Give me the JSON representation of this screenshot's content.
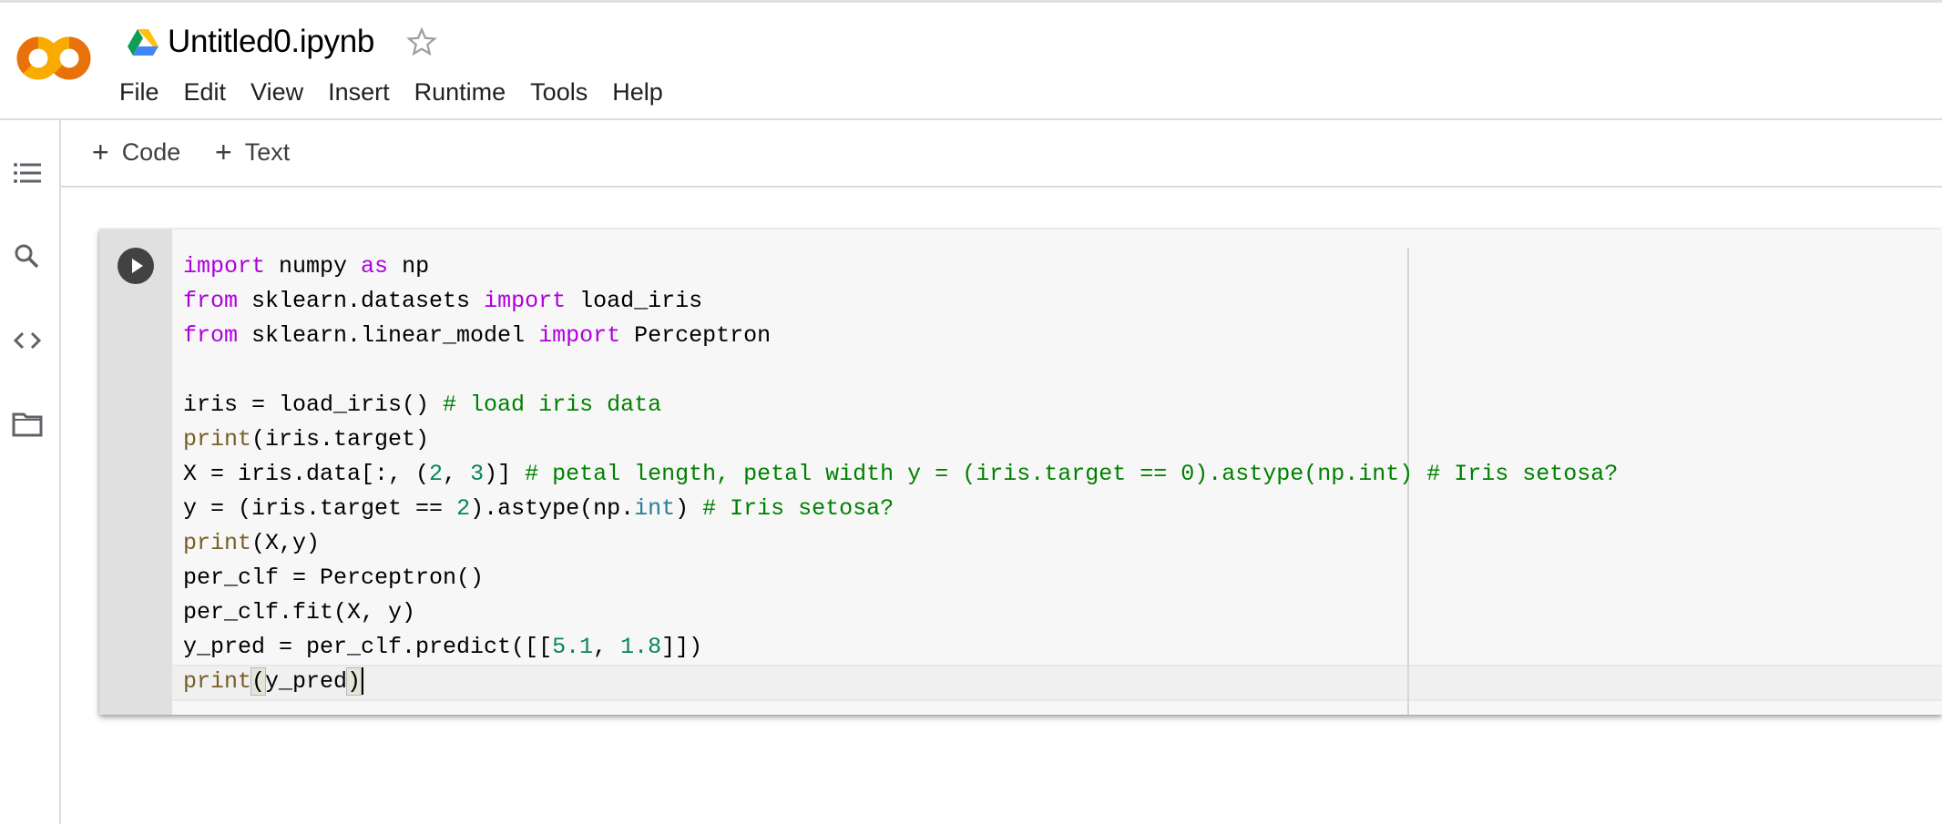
{
  "app": {
    "logo": "colab-logo",
    "title": "Untitled0.ipynb",
    "drive_icon": "google-drive-icon",
    "star_icon": "star-outline-icon"
  },
  "menu": [
    "File",
    "Edit",
    "View",
    "Insert",
    "Runtime",
    "Tools",
    "Help"
  ],
  "rail": [
    {
      "name": "table-of-contents-icon"
    },
    {
      "name": "search-icon"
    },
    {
      "name": "code-snippets-icon"
    },
    {
      "name": "files-icon"
    }
  ],
  "toolbar": {
    "add_code_label": "Code",
    "add_text_label": "Text"
  },
  "colors": {
    "keyword": "#af00db",
    "builtin": "#795e26",
    "comment": "#008000",
    "number": "#098658",
    "type": "#267f99"
  },
  "cell": {
    "run_button": "play-icon",
    "lines": [
      [
        {
          "t": "import",
          "c": "kw"
        },
        {
          "t": " numpy "
        },
        {
          "t": "as",
          "c": "kw"
        },
        {
          "t": " np"
        }
      ],
      [
        {
          "t": "from",
          "c": "kw"
        },
        {
          "t": " sklearn.datasets "
        },
        {
          "t": "import",
          "c": "kw"
        },
        {
          "t": " load_iris"
        }
      ],
      [
        {
          "t": "from",
          "c": "kw"
        },
        {
          "t": " sklearn.linear_model "
        },
        {
          "t": "import",
          "c": "kw"
        },
        {
          "t": " Perceptron"
        }
      ],
      [],
      [
        {
          "t": "iris = load_iris() "
        },
        {
          "t": "# load iris data",
          "c": "cm"
        }
      ],
      [
        {
          "t": "print",
          "c": "bi"
        },
        {
          "t": "(iris.target)"
        }
      ],
      [
        {
          "t": "X = iris.data[:, ("
        },
        {
          "t": "2",
          "c": "nm"
        },
        {
          "t": ", "
        },
        {
          "t": "3",
          "c": "nm"
        },
        {
          "t": ")] "
        },
        {
          "t": "# petal length, petal width y = (iris.target == 0).astype(np.int) # Iris setosa?",
          "c": "cm"
        }
      ],
      [
        {
          "t": "y = (iris.target == "
        },
        {
          "t": "2",
          "c": "nm"
        },
        {
          "t": ").astype(np."
        },
        {
          "t": "int",
          "c": "ty"
        },
        {
          "t": ") "
        },
        {
          "t": "# Iris setosa?",
          "c": "cm"
        }
      ],
      [
        {
          "t": "print",
          "c": "bi"
        },
        {
          "t": "(X,y)"
        }
      ],
      [
        {
          "t": "per_clf = Perceptron()"
        }
      ],
      [
        {
          "t": "per_clf.fit(X, y)"
        }
      ],
      [
        {
          "t": "y_pred = per_clf.predict([["
        },
        {
          "t": "5.1",
          "c": "nm"
        },
        {
          "t": ", "
        },
        {
          "t": "1.8",
          "c": "nm"
        },
        {
          "t": "]])"
        }
      ],
      [
        {
          "t": "print",
          "c": "bi"
        },
        {
          "t": "(",
          "c": "bracket"
        },
        {
          "t": "y_pred"
        },
        {
          "t": ")",
          "c": "bracket"
        },
        {
          "t": "",
          "c": "cursor"
        }
      ]
    ]
  }
}
